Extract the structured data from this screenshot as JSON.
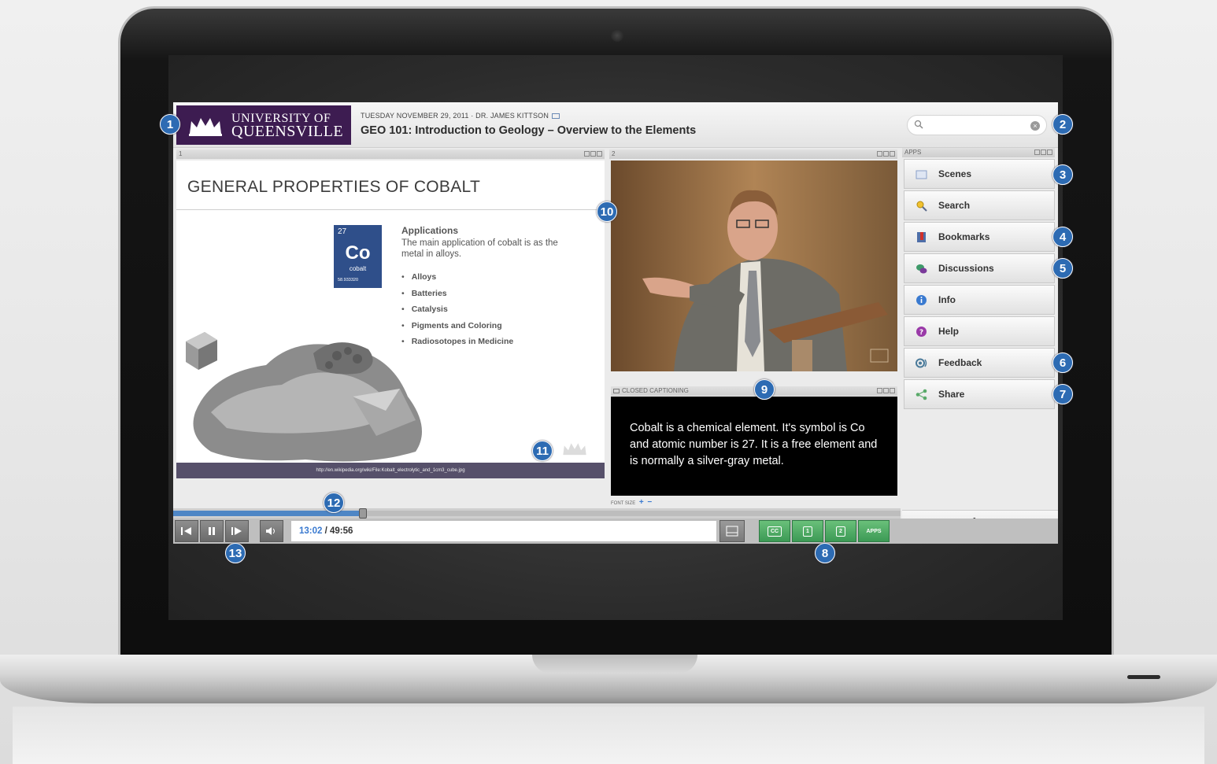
{
  "header": {
    "logo_line1": "UNIVERSITY OF",
    "logo_line2": "QUEENSVILLE",
    "meta": "TUESDAY NOVEMBER 29, 2011 · DR. JAMES KITTSON",
    "title": "GEO 101:  Introduction to Geology – Overview to the Elements"
  },
  "search": {
    "value": ""
  },
  "panels": {
    "slide_label": "1",
    "video_label": "2",
    "cc_label": "CLOSED CAPTIONING",
    "apps_label": "APPS"
  },
  "slide": {
    "title": "GENERAL PROPERTIES OF COBALT",
    "element_number": "27",
    "element_symbol": "Co",
    "element_name": "cobalt",
    "element_mass": "58.933320",
    "applications_heading": "Applications",
    "applications_text": "The main application of cobalt is as the metal in alloys.",
    "bullets": [
      "Alloys",
      "Batteries",
      "Catalysis",
      "Pigments and Coloring",
      "Radiosotopes in Medicine"
    ],
    "source_url": "http://en.wikipedia.org/wiki/File:Kobalt_electrolytic_and_1cm3_cube.jpg"
  },
  "captions": {
    "text": "Cobalt is a chemical element. It's symbol is Co and atomic number is 27. It is a free element and is normally a silver-gray metal.",
    "font_size_label": "FONT SIZE"
  },
  "apps": [
    {
      "label": "Scenes",
      "icon": "scenes-icon"
    },
    {
      "label": "Search",
      "icon": "search-icon"
    },
    {
      "label": "Bookmarks",
      "icon": "bookmark-icon"
    },
    {
      "label": "Discussions",
      "icon": "discussion-icon"
    },
    {
      "label": "Info",
      "icon": "info-icon"
    },
    {
      "label": "Help",
      "icon": "help-icon"
    },
    {
      "label": "Feedback",
      "icon": "feedback-icon"
    },
    {
      "label": "Share",
      "icon": "share-icon"
    }
  ],
  "player": {
    "current_time": "13:02",
    "total_time": " / 49:56",
    "progress_fraction": 0.2606,
    "view_buttons": [
      "CC",
      "1",
      "2",
      "APPS"
    ]
  },
  "brand": {
    "logo": "echo"
  },
  "markers": [
    "1",
    "2",
    "3",
    "4",
    "5",
    "6",
    "7",
    "8",
    "9",
    "10",
    "11",
    "12",
    "13"
  ],
  "colors": {
    "accent": "#2d6bb3",
    "logo_bg": "#3d1c51",
    "view_button": "#3c9a55"
  }
}
